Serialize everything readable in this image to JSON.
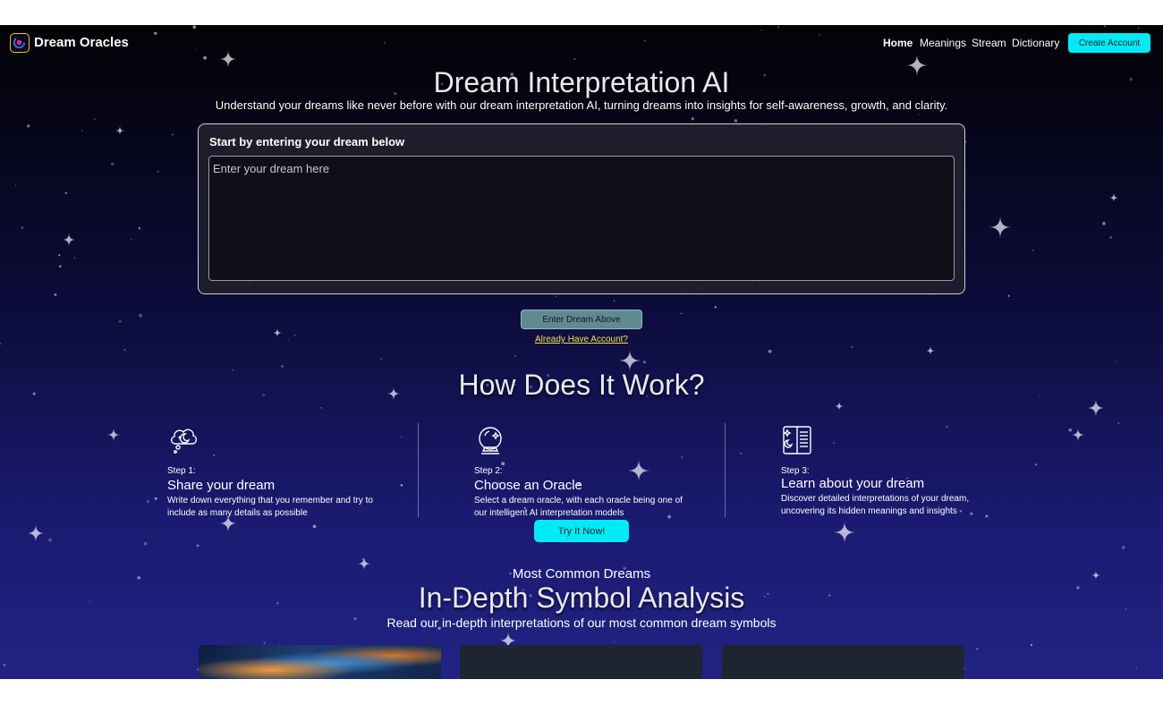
{
  "nav": {
    "brand": "Dream Oracles",
    "links": [
      "Home",
      "Meanings",
      "Stream",
      "Dictionary"
    ],
    "cta": "Create Account"
  },
  "hero": {
    "title": "Dream Interpretation AI",
    "subtitle": "Understand your dreams like never before with our dream interpretation AI, turning dreams into insights for self-awareness, growth, and clarity.",
    "card_label": "Start by entering your dream below",
    "input_placeholder": "Enter your dream here",
    "submit_label": "Enter Dream Above",
    "account_link": "Already Have Account?"
  },
  "how": {
    "title": "How Does It Work?",
    "steps": [
      {
        "num": "Step 1:",
        "title": "Share your dream",
        "desc": "Write down everything that you remember and try to include as many details as possible",
        "icon": "thought-cloud-icon"
      },
      {
        "num": "Step 2:",
        "title": "Choose an Oracle",
        "desc": "Select a dream oracle, with each oracle being one of our intelligent AI interpretation models",
        "icon": "crystal-ball-icon"
      },
      {
        "num": "Step 3:",
        "title": "Learn about your dream",
        "desc": "Discover detailed interpretations of your dream, uncovering its hidden meanings and insights",
        "icon": "dream-book-icon"
      }
    ],
    "try_label": "Try It Now!"
  },
  "symbols": {
    "kicker": "Most Common Dreams",
    "title": "In-Depth Symbol Analysis",
    "subtitle": "Read our in-depth interpretations of our most common dream symbols"
  },
  "colors": {
    "accent": "#00eaf6",
    "link": "#f6e046",
    "logo_border": "#f3c02b",
    "bg_top": "#030306",
    "bg_bottom": "#222284"
  }
}
